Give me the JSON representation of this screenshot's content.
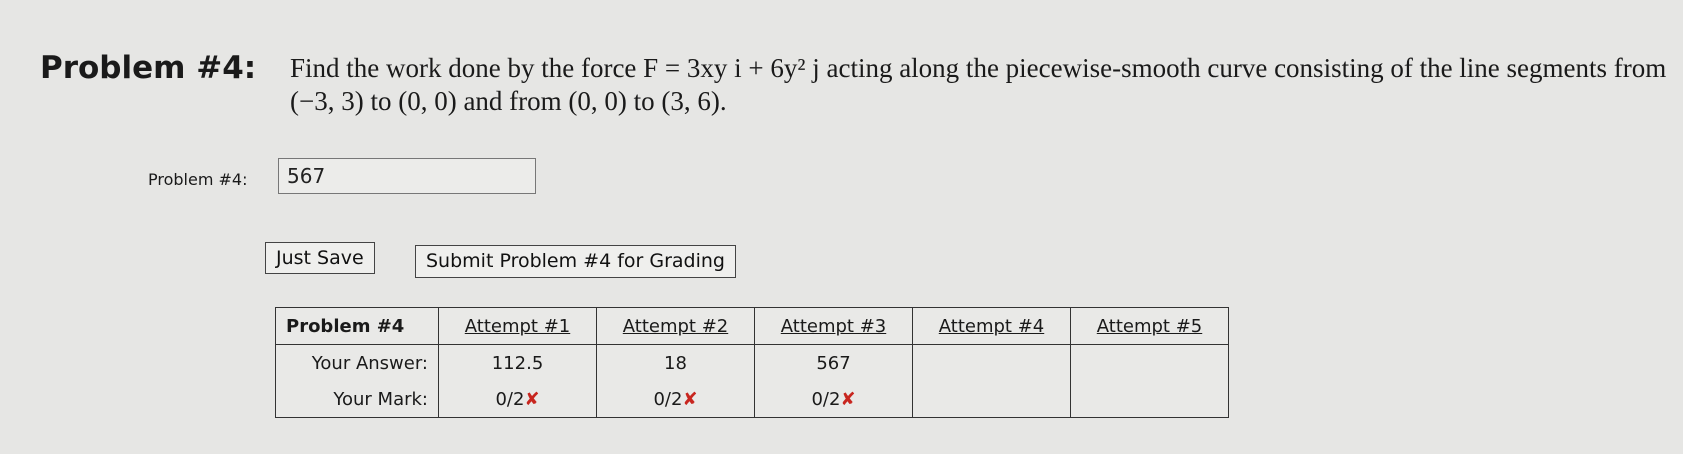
{
  "problem": {
    "label": "Problem #4:",
    "text": "Find the work done by the force F = 3xy i + 6y² j acting along the piecewise-smooth curve consisting of the line segments from (−3, 3) to (0, 0) and from (0, 0) to (3, 6)."
  },
  "answer": {
    "label": "Problem #4:",
    "value": "567"
  },
  "buttons": {
    "save_label": "Just Save",
    "submit_label": "Submit Problem #4 for Grading"
  },
  "attempts_table": {
    "header": [
      "Problem #4",
      "Attempt #1",
      "Attempt #2",
      "Attempt #3",
      "Attempt #4",
      "Attempt #5"
    ],
    "row_labels": {
      "answer": "Your Answer:",
      "mark": "Your Mark:"
    },
    "answers": [
      "112.5",
      "18",
      "567",
      "",
      ""
    ],
    "marks": [
      "0/2",
      "0/2",
      "0/2",
      "",
      ""
    ],
    "mark_symbol": "✘",
    "mark_color": "#c8261f"
  }
}
